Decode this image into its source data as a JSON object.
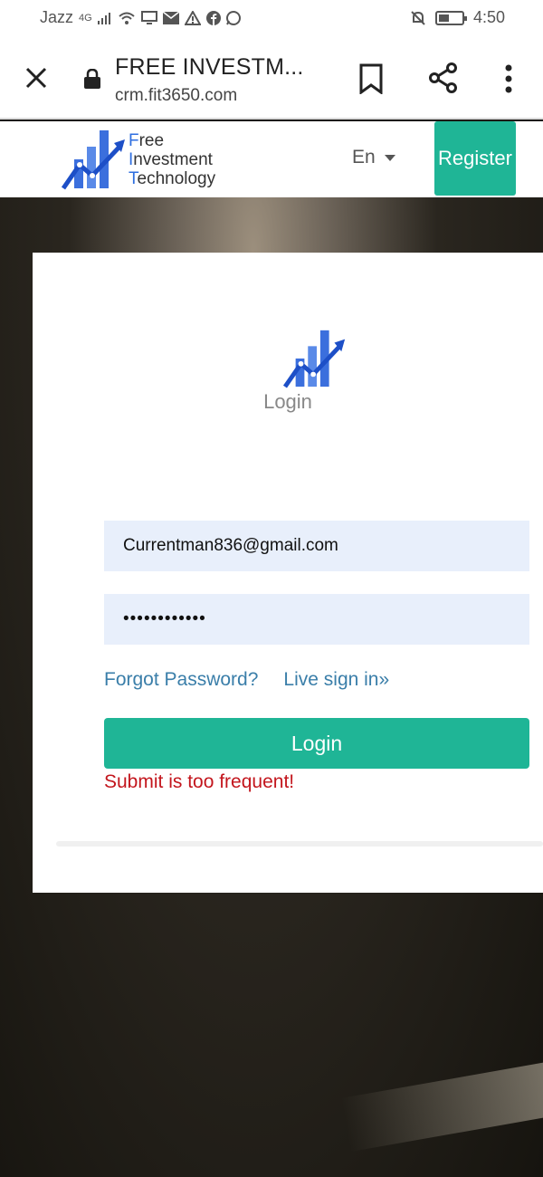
{
  "status_bar": {
    "carrier": "Jazz",
    "network": "4G",
    "time": "4:50"
  },
  "browser": {
    "title": "FREE INVESTM...",
    "url": "crm.fit3650.com"
  },
  "site_header": {
    "logo_lines": [
      {
        "initial": "F",
        "rest": "ree"
      },
      {
        "initial": "I",
        "rest": "nvestment"
      },
      {
        "initial": "T",
        "rest": "echnology"
      }
    ],
    "language": "En",
    "register_label": "Register"
  },
  "login_card": {
    "title": "Login",
    "email_value": "Currentman836@gmail.com",
    "password_value": "••••••••••••",
    "forgot_password": "Forgot Password?",
    "live_sign_in": "Live sign in»",
    "login_button": "Login",
    "error_message": "Submit is too frequent!"
  },
  "colors": {
    "brand_green": "#1fb596",
    "link_blue": "#3a7ea9",
    "error_red": "#c3161d",
    "input_bg": "#e8effb"
  }
}
